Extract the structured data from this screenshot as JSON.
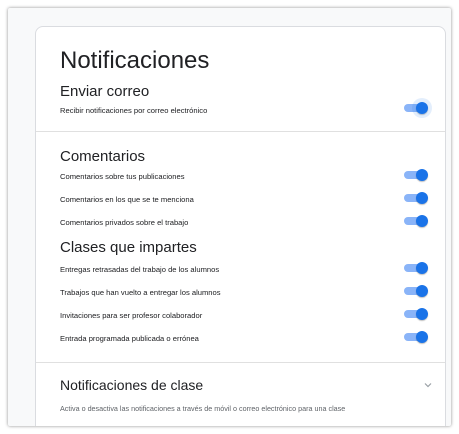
{
  "page": {
    "title": "Notificaciones"
  },
  "sections": {
    "email": {
      "title": "Enviar correo",
      "items": [
        {
          "label": "Recibir notificaciones por correo electrónico",
          "enabled": true
        }
      ]
    },
    "comments": {
      "title": "Comentarios",
      "items": [
        {
          "label": "Comentarios sobre tus publicaciones",
          "enabled": true
        },
        {
          "label": "Comentarios en los que se te menciona",
          "enabled": true
        },
        {
          "label": "Comentarios privados sobre el trabajo",
          "enabled": true
        }
      ]
    },
    "teaching": {
      "title": "Clases que impartes",
      "items": [
        {
          "label": "Entregas retrasadas del trabajo de los alumnos",
          "enabled": true
        },
        {
          "label": "Trabajos que han vuelto a entregar los alumnos",
          "enabled": true
        },
        {
          "label": "Invitaciones para ser profesor colaborador",
          "enabled": true
        },
        {
          "label": "Entrada programada publicada o errónea",
          "enabled": true
        }
      ]
    },
    "class_notifications": {
      "title": "Notificaciones de clase",
      "description": "Activa o desactiva las notificaciones a través de móvil o correo electrónico para una clase",
      "expand_icon": "chevron-down-icon"
    }
  },
  "colors": {
    "toggle_on_thumb": "#1a73e8",
    "toggle_on_track": "#8ab4f8"
  }
}
